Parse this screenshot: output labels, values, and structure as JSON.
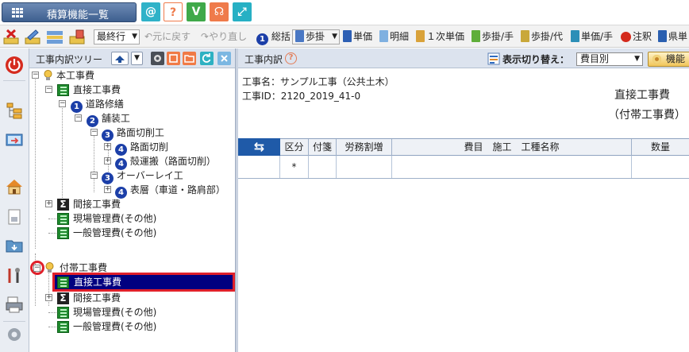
{
  "topbar": {
    "menu_label": "積算機能一覧",
    "at_label": "@",
    "help_label": "?",
    "beginner_label": "V",
    "support_label": "☊",
    "expand_label": "⤢"
  },
  "toolbar": {
    "final_row": "最終行",
    "undo": "元に戻す",
    "redo": "やり直し",
    "total": "総括",
    "num_total": "1",
    "ratio_combo": "歩掛",
    "unit_price": "単価",
    "details": "明細",
    "first_unit_price": "１次単価",
    "ratio_hand": "歩掛/手",
    "ratio_sub": "歩掛/代",
    "unit_hand": "単価/手",
    "note": "注釈",
    "prefecture": "県単"
  },
  "tree": {
    "title": "工事内訳ツリー",
    "nodes": [
      {
        "label": "本工事費",
        "num": ""
      },
      {
        "label": "直接工事費",
        "num": ""
      },
      {
        "label": "道路修繕",
        "num": "1"
      },
      {
        "label": "舗装工",
        "num": "2"
      },
      {
        "label": "路面切削工",
        "num": "3"
      },
      {
        "label": "路面切削",
        "num": "4"
      },
      {
        "label": "殻運搬（路面切削）",
        "num": "4"
      },
      {
        "label": "オーバーレイ工",
        "num": "3"
      },
      {
        "label": "表層（車道・路肩部）",
        "num": "4"
      },
      {
        "label": "間接工事費",
        "num": ""
      },
      {
        "label": "現場管理費(その他)",
        "num": ""
      },
      {
        "label": "一般管理費(その他)",
        "num": ""
      },
      {
        "label": "付帯工事費",
        "num": ""
      },
      {
        "label": "直接工事費",
        "num": ""
      },
      {
        "label": "間接工事費",
        "num": ""
      },
      {
        "label": "現場管理費(その他)",
        "num": ""
      },
      {
        "label": "一般管理費(その他)",
        "num": ""
      }
    ]
  },
  "detail": {
    "title": "工事内訳",
    "view_toggle_label": "表示切り替え：",
    "view_select": "費目別",
    "func_button": "機能",
    "project_name": "工事名：サンプル工事（公共土木）",
    "project_id": "工事ID：2120_2019_41-0",
    "heading1": "直接工事費",
    "heading2": "（付帯工事費）"
  },
  "grid": {
    "swap_label": "⇆",
    "columns": [
      "区分",
      "付箋",
      "労務割増",
      "費目　施工　工種名称",
      "数量"
    ],
    "rows": [
      [
        "*",
        "",
        "",
        "",
        ""
      ]
    ]
  },
  "colors": {
    "selection": "#000080",
    "accent": "#1f5aa8",
    "highlight": "#e0202a"
  }
}
